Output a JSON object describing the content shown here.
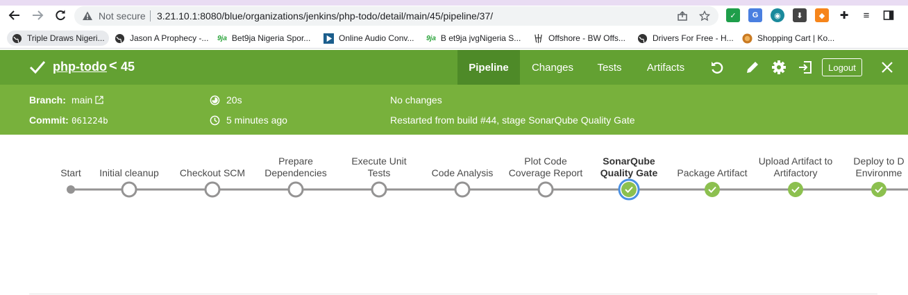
{
  "browser": {
    "security_label": "Not secure",
    "url": "3.21.10.1:8080/blue/organizations/jenkins/php-todo/detail/main/45/pipeline/37/",
    "bookmarks": [
      {
        "label": "Triple Draws Nigeri...",
        "icon": "globe-icon"
      },
      {
        "label": "Jason A Prophecy -...",
        "icon": "globe-icon"
      },
      {
        "label": "Bet9ja Nigeria Spor...",
        "icon": "bet9ja-logo-icon",
        "icon_text": "9ja"
      },
      {
        "label": "Online Audio Conv...",
        "icon": "play-icon"
      },
      {
        "label": "B et9ja jvgNigeria S...",
        "icon": "bet9ja-logo-icon",
        "icon_text": "9ja"
      },
      {
        "label": "Offshore - BW Offs...",
        "icon": "offshore-icon"
      },
      {
        "label": "Drivers For Free - H...",
        "icon": "globe-icon"
      },
      {
        "label": "Shopping Cart | Ko...",
        "icon": "cart-icon"
      }
    ]
  },
  "header": {
    "project": "php-todo",
    "separator": "<",
    "build_number": "45",
    "tabs": [
      {
        "label": "Pipeline",
        "active": true
      },
      {
        "label": "Changes",
        "active": false
      },
      {
        "label": "Tests",
        "active": false
      },
      {
        "label": "Artifacts",
        "active": false
      }
    ],
    "logout_label": "Logout"
  },
  "run": {
    "branch_label": "Branch:",
    "branch": "main",
    "commit_label": "Commit:",
    "commit": "061224b",
    "duration": "20s",
    "started": "5 minutes ago",
    "changes": "No changes",
    "cause": "Restarted from build #44, stage SonarQube Quality Gate"
  },
  "pipeline": {
    "stages": [
      {
        "name": "Start",
        "lines": [
          "Start"
        ],
        "status": "start"
      },
      {
        "name": "Initial cleanup",
        "lines": [
          "Initial cleanup"
        ],
        "status": "not_built"
      },
      {
        "name": "Checkout SCM",
        "lines": [
          "Checkout SCM"
        ],
        "status": "not_built"
      },
      {
        "name": "Prepare Dependencies",
        "lines": [
          "Prepare",
          "Dependencies"
        ],
        "status": "not_built"
      },
      {
        "name": "Execute Unit Tests",
        "lines": [
          "Execute Unit",
          "Tests"
        ],
        "status": "not_built"
      },
      {
        "name": "Code Analysis",
        "lines": [
          "Code Analysis"
        ],
        "status": "not_built"
      },
      {
        "name": "Plot Code Coverage Report",
        "lines": [
          "Plot Code",
          "Coverage Report"
        ],
        "status": "not_built"
      },
      {
        "name": "SonarQube Quality Gate",
        "lines": [
          "SonarQube",
          "Quality Gate"
        ],
        "status": "success",
        "selected": true
      },
      {
        "name": "Package Artifact",
        "lines": [
          "Package Artifact"
        ],
        "status": "success"
      },
      {
        "name": "Upload Artifact to Artifactory",
        "lines": [
          "Upload Artifact to",
          "Artifactory"
        ],
        "status": "success"
      },
      {
        "name": "Deploy to Dev Environment",
        "lines": [
          "Deploy to D",
          "Environme"
        ],
        "status": "success"
      }
    ]
  },
  "colors": {
    "header_bg": "#63a132",
    "info_bg": "#78b13c",
    "success": "#8cc04f",
    "not_built": "#949393",
    "selected_ring": "#4a90e2"
  }
}
